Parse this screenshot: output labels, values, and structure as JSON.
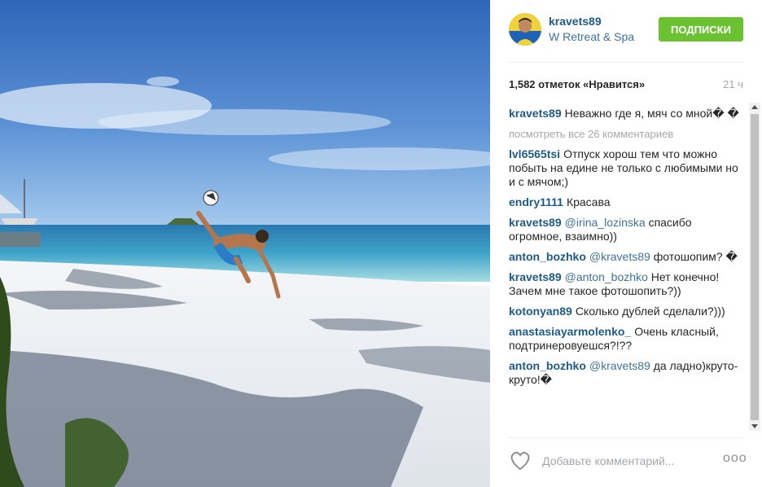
{
  "post": {
    "username": "kravets89",
    "location": "W Retreat & Spa",
    "follow_label": "ПОДПИСКИ",
    "likes": "1,582 отметок «Нравится»",
    "time": "21 ч"
  },
  "comments": {
    "caption": {
      "author": "kravets89",
      "text": "Неважно где я, мяч со мной� �"
    },
    "view_all": "посмотреть все 26 комментариев",
    "items": [
      {
        "author": "lvl6565tsi",
        "mention": "",
        "text": "Отпуск хорош тем что можно побыть на едине не только с любимыми но и с мячом;)"
      },
      {
        "author": "endry1111",
        "mention": "",
        "text": "Красава"
      },
      {
        "author": "kravets89",
        "mention": "@irina_lozinska",
        "text": "спасибо огромное, взаимно))"
      },
      {
        "author": "anton_bozhko",
        "mention": "@kravets89",
        "text": "фотошопим? �"
      },
      {
        "author": "kravets89",
        "mention": "@anton_bozhko",
        "text": "Нет конечно! Зачем мне такое фотошопить?))"
      },
      {
        "author": "kotonyan89",
        "mention": "",
        "text": "Сколько дублей сделали?)))"
      },
      {
        "author": "anastasiayarmolenko_",
        "mention": "",
        "text": "Очень класный, подтринеровуешся?!??"
      },
      {
        "author": "anton_bozhko",
        "mention": "@kravets89",
        "text": "да ладно)круто-круто!�"
      }
    ]
  },
  "footer": {
    "comment_placeholder": "Добавьте комментарий...",
    "more_label": "ooo"
  },
  "icons": {
    "heart": "heart-outline-icon",
    "more": "more-options-icon"
  },
  "colors": {
    "follow_green": "#6bc231",
    "username_blue": "#1e5a89",
    "link_blue": "#3f729b",
    "muted_gray": "#a5a7aa"
  }
}
